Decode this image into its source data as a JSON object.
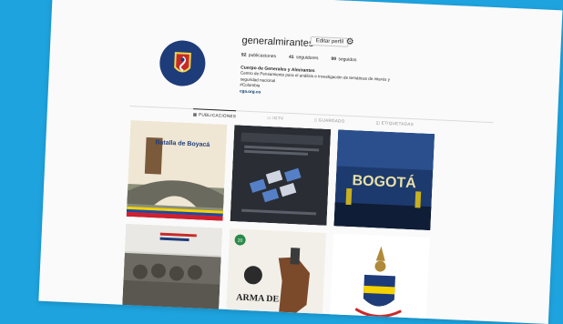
{
  "profile": {
    "username": "generalmirantes",
    "edit_label": "Editar perfil",
    "settings_icon": "gear-icon",
    "stats": [
      {
        "count": "92",
        "label": "publicaciones"
      },
      {
        "count": "41",
        "label": "seguidores"
      },
      {
        "count": "99",
        "label": "seguidos"
      }
    ],
    "name": "Cuerpo de Generales y Almirantes",
    "bio_lines": [
      "Centro de Pensamiento para el análisis e investigación de temáticas de interés y",
      "seguridad nacional",
      "#Colombia"
    ],
    "link": "cga.org.co"
  },
  "tabs": [
    {
      "label": "PUBLICACIONES",
      "icon": "grid-icon"
    },
    {
      "label": "IGTV",
      "icon": "tv-icon"
    },
    {
      "label": "GUARDADO",
      "icon": "bookmark-icon"
    },
    {
      "label": "ETIQUETADAS",
      "icon": "tag-icon"
    }
  ],
  "posts": [
    {
      "title": "Batalla de Boyacá",
      "subtitle": ""
    },
    {
      "title": "",
      "subtitle": ""
    },
    {
      "title": "BOGOTÁ",
      "subtitle": ""
    },
    {
      "title": "",
      "subtitle": ""
    },
    {
      "title": "ARMA DE",
      "subtitle": "20"
    },
    {
      "title": "",
      "subtitle": ""
    }
  ],
  "colors": {
    "background": "#1ea3de",
    "logo_bg": "#1f3c7a",
    "link": "#00376b",
    "text": "#262626"
  }
}
